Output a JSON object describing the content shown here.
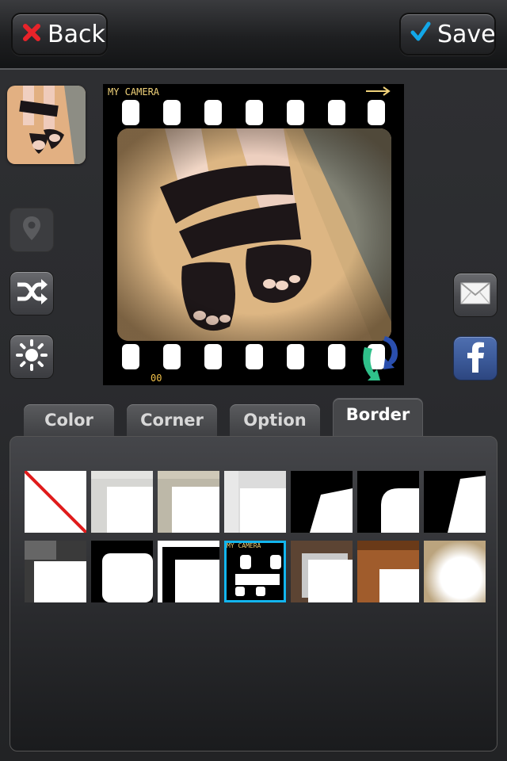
{
  "topbar": {
    "back_label": "Back",
    "save_label": "Save"
  },
  "photo": {
    "brand_text": "MY CAMERA",
    "frame_counter": "00"
  },
  "tabs": [
    {
      "label": "Color",
      "active": false
    },
    {
      "label": "Corner",
      "active": false
    },
    {
      "label": "Option",
      "active": false
    },
    {
      "label": "Border",
      "active": true
    }
  ],
  "borders": {
    "selected_index": 10,
    "items": [
      "none",
      "white-paper",
      "beige-paper",
      "striped-corner",
      "black-cut-corner",
      "black-round-corner",
      "black-cut-corner-2",
      "grunge-light",
      "grunge-white",
      "brush-black",
      "film-strip",
      "wood-metal",
      "wood-ornate",
      "vintage-fade"
    ]
  },
  "colors": {
    "accent": "#12b5ee",
    "close_red": "#e8232a",
    "check_blue": "#12a7e8",
    "facebook_blue": "#3b5998"
  }
}
